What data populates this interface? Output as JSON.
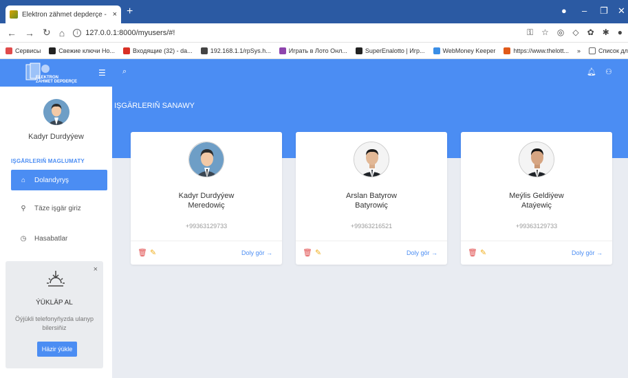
{
  "browser": {
    "tab_title": "Elektron zähmet depderçe - IŞGÄ",
    "tab_close": "×",
    "new_tab": "+",
    "url": "127.0.0.1:8000/myusers/#!",
    "bookmarks": [
      {
        "label": "Сервисы",
        "color": "#e04b4b"
      },
      {
        "label": "Свежие ключи Но...",
        "color": "#222222"
      },
      {
        "label": "Входящие (32) - da...",
        "color": "#d93025"
      },
      {
        "label": "192.168.1.1/rpSys.h...",
        "color": "#444444"
      },
      {
        "label": "Играть в Лото Онл...",
        "color": "#8e44ad"
      },
      {
        "label": "SuperEnalotto | Игр...",
        "color": "#222222"
      },
      {
        "label": "WebMoney Keeper",
        "color": "#3a8ee6"
      },
      {
        "label": "https://www.thelott...",
        "color": "#e05a1a"
      }
    ],
    "bookmarks_more": "»",
    "reading_list": "Список для чтени"
  },
  "sidebar": {
    "user_name": "Kadyr Durdyýew",
    "section_title": "IŞGÄRLERIŇ MAGLUMATY",
    "items": [
      {
        "label": "Dolandyryş",
        "icon": "home-icon",
        "active": true
      },
      {
        "label": "Täze işgär giriz",
        "icon": "add-user-icon",
        "active": false
      },
      {
        "label": "Hasabatlar",
        "icon": "clock-icon",
        "active": false
      }
    ],
    "promo": {
      "title": "ÝÜKLÄP AL",
      "text": "Öýjükli telefonyňyzda ulanyp bilersiňiz",
      "button": "Häzir ýükle",
      "close": "×"
    }
  },
  "main": {
    "title": "IŞGÄRLERIŇ SANAWY",
    "cards": [
      {
        "name_line1": "Kadyr Durdyýew",
        "name_line2": "Meredowiç",
        "phone": "+99363129733",
        "more": "Doly gör →",
        "avatar": "cartoon"
      },
      {
        "name_line1": "Arslan Batyrow",
        "name_line2": "Batyrowiç",
        "phone": "+99363216521",
        "more": "Doly gör →",
        "avatar": "photo"
      },
      {
        "name_line1": "Meýlis Geldiýew",
        "name_line2": "Ataýewiç",
        "phone": "+99363129733",
        "more": "Doly gör →",
        "avatar": "photo"
      }
    ]
  },
  "colors": {
    "primary": "#4b8df3",
    "browser_frame": "#2b5aa3",
    "delete": "#e04b4b",
    "edit": "#f0ad1a",
    "background": "#e9ecf2"
  }
}
